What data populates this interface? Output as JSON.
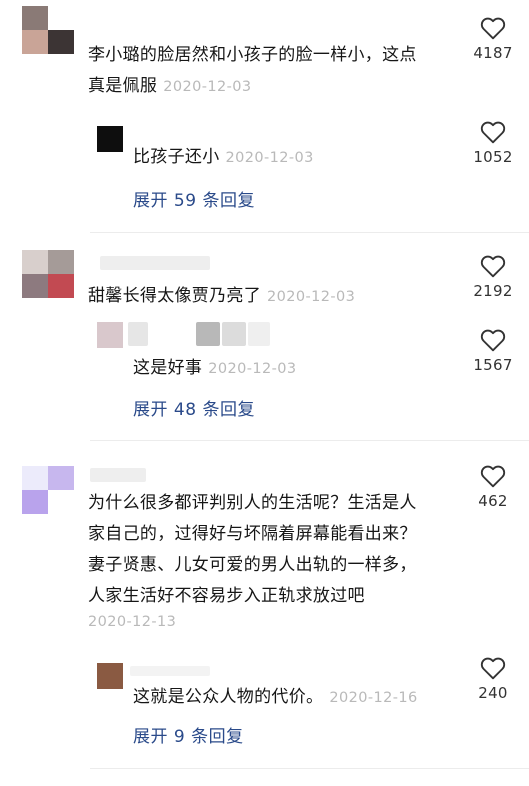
{
  "comments": [
    {
      "text": "李小璐的脸居然和小孩子的脸一样小，这点真是佩服",
      "line1": "李小璐的脸居然和小孩子的脸一样小，这点",
      "line2": "真是佩服",
      "date": "2020-12-03",
      "likes": "4187",
      "reply": {
        "text": "比孩子还小",
        "date": "2020-12-03",
        "likes": "1052"
      },
      "expand": "展开 59 条回复"
    },
    {
      "text": "甜馨长得太像贾乃亮了",
      "date": "2020-12-03",
      "likes": "2192",
      "reply": {
        "text": "这是好事",
        "date": "2020-12-03",
        "likes": "1567"
      },
      "expand": "展开 48 条回复"
    },
    {
      "line1": "为什么很多都评判别人的生活呢？生活是人",
      "line2": "家自己的，过得好与坏隔着屏幕能看出来？",
      "line3": "妻子贤惠、儿女可爱的男人出轨的一样多，",
      "line4": "人家生活好不容易步入正轨求放过吧",
      "date": "2020-12-13",
      "likes": "462",
      "reply": {
        "text": "这就是公众人物的代价。",
        "date": "2020-12-16",
        "likes": "240"
      },
      "expand": "展开 9 条回复"
    }
  ],
  "icons": {
    "like": "heart-outline-icon"
  },
  "colors": {
    "expand_link": "#2a4a8a",
    "date": "#b9b9b9"
  }
}
